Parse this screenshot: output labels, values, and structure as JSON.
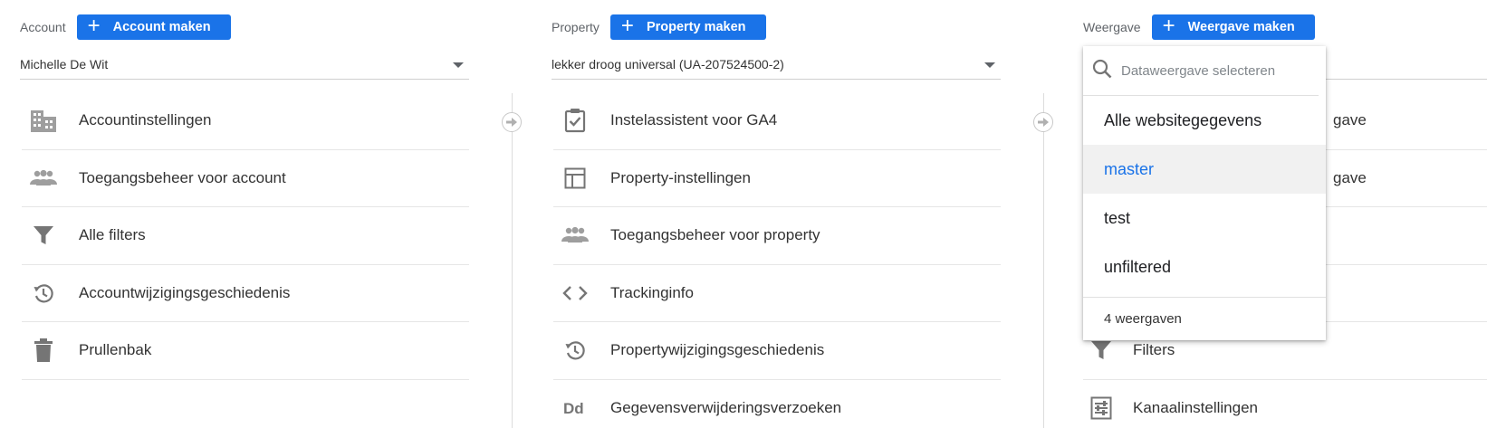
{
  "columns": {
    "account": {
      "label": "Account",
      "create_label": "Account maken",
      "selected": "Michelle De Wit",
      "items": [
        {
          "label": "Accountinstellingen",
          "icon": "building-icon"
        },
        {
          "label": "Toegangsbeheer voor account",
          "icon": "people-icon"
        },
        {
          "label": "Alle filters",
          "icon": "filter-icon"
        },
        {
          "label": "Accountwijzigingsgeschiedenis",
          "icon": "history-icon"
        },
        {
          "label": "Prullenbak",
          "icon": "trash-icon"
        }
      ]
    },
    "property": {
      "label": "Property",
      "create_label": "Property maken",
      "selected": "lekker droog universal (UA-207524500-2)",
      "items": [
        {
          "label": "Instelassistent voor GA4",
          "icon": "clipboard-check-icon"
        },
        {
          "label": "Property-instellingen",
          "icon": "layout-icon"
        },
        {
          "label": "Toegangsbeheer voor property",
          "icon": "people-icon"
        },
        {
          "label": "Trackinginfo",
          "icon": "code-icon"
        },
        {
          "label": "Propertywijzigingsgeschiedenis",
          "icon": "history-icon"
        },
        {
          "label": "Gegevensverwijderingsverzoeken",
          "icon": "dd-icon"
        }
      ]
    },
    "view": {
      "label": "Weergave",
      "create_label": "Weergave maken",
      "items": [
        {
          "label": "gave",
          "icon": ""
        },
        {
          "label": "gave",
          "icon": ""
        },
        {
          "label": "",
          "icon": ""
        },
        {
          "label": "",
          "icon": ""
        },
        {
          "label": "Filters",
          "icon": "filter-icon"
        },
        {
          "label": "Kanaalinstellingen",
          "icon": "channel-settings-icon"
        }
      ]
    }
  },
  "view_dropdown": {
    "search_placeholder": "Dataweergave selecteren",
    "options": [
      {
        "label": "Alle websitegegevens",
        "selected": false
      },
      {
        "label": "master",
        "selected": true
      },
      {
        "label": "test",
        "selected": false
      },
      {
        "label": "unfiltered",
        "selected": false
      }
    ],
    "footer": "4 weergaven"
  },
  "colors": {
    "accent": "#1a73e8",
    "icon_gray": "#757575",
    "selected_bg": "#f1f1f1"
  }
}
